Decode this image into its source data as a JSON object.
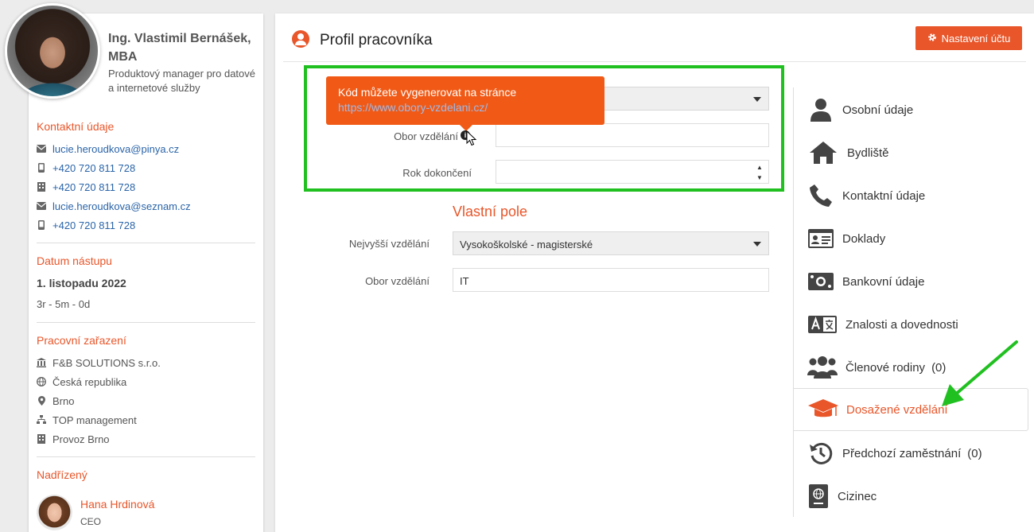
{
  "profile": {
    "name": "Ing. Vlastimil Bernášek, MBA",
    "position": "Produktový manager pro datové a internetové služby"
  },
  "contact": {
    "title": "Kontaktní údaje",
    "items": [
      {
        "icon": "envelope-icon",
        "value": "lucie.heroudkova@pinya.cz"
      },
      {
        "icon": "mobile-icon",
        "value": "+420 720 811 728"
      },
      {
        "icon": "building-icon",
        "value": "+420 720 811 728"
      },
      {
        "icon": "envelope-icon",
        "value": "lucie.heroudkova@seznam.cz"
      },
      {
        "icon": "mobile-icon",
        "value": "+420 720 811 728"
      }
    ]
  },
  "start": {
    "title": "Datum nástupu",
    "date": "1. listopadu 2022",
    "duration": "3r - 5m - 0d"
  },
  "work": {
    "title": "Pracovní zařazení",
    "items": [
      {
        "icon": "bank-icon",
        "value": "F&B SOLUTIONS s.r.o."
      },
      {
        "icon": "globe-icon",
        "value": "Česká republika"
      },
      {
        "icon": "map-marker-icon",
        "value": "Brno"
      },
      {
        "icon": "sitemap-icon",
        "value": "TOP management"
      },
      {
        "icon": "building-icon",
        "value": "Provoz Brno"
      }
    ]
  },
  "supervisor": {
    "title": "Nadřízený",
    "name": "Hana Hrdinová",
    "role": "CEO"
  },
  "header": {
    "title": "Profil pracovníka",
    "settings_label": "Nastavení účtu"
  },
  "tooltip": {
    "line1": "Kód můžete vygenerovat na stránce",
    "line2": "https://www.obory-vzdelani.cz/"
  },
  "form_top": {
    "obor_label": "Obor vzdělání",
    "obor_value": "",
    "rok_label": "Rok dokončení",
    "rok_value": ""
  },
  "custom": {
    "title": "Vlastní pole",
    "highest_label": "Nejvyšší vzdělání",
    "highest_value": "Vysokoškolské - magisterské",
    "obor_label": "Obor vzdělání",
    "obor_value": "IT"
  },
  "nav": {
    "items": [
      {
        "icon": "user-icon",
        "label": "Osobní údaje"
      },
      {
        "icon": "home-icon",
        "label": "Bydliště"
      },
      {
        "icon": "phone-icon",
        "label": "Kontaktní údaje"
      },
      {
        "icon": "id-card-icon",
        "label": "Doklady"
      },
      {
        "icon": "money-icon",
        "label": "Bankovní údaje"
      },
      {
        "icon": "language-icon",
        "label": "Znalosti a dovednosti"
      },
      {
        "icon": "users-icon",
        "label": "Členové rodiny",
        "count": "(0)"
      },
      {
        "icon": "graduation-cap-icon",
        "label": "Dosažené vzdělání"
      },
      {
        "icon": "history-icon",
        "label": "Předchozí zaměstnání",
        "count": "(0)"
      },
      {
        "icon": "passport-icon",
        "label": "Cizinec"
      }
    ],
    "active_index": 7
  },
  "colors": {
    "accent": "#e8562a",
    "link": "#2a64a8",
    "highlight": "#21c021"
  }
}
